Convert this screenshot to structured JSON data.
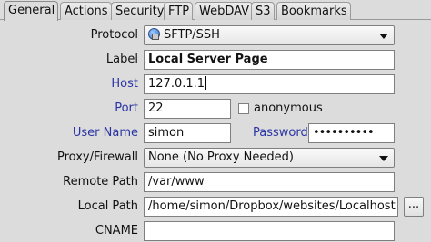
{
  "tabs": [
    {
      "label": "General",
      "active": true
    },
    {
      "label": "Actions"
    },
    {
      "label": "Security"
    },
    {
      "label": "FTP"
    },
    {
      "label": "WebDAV"
    },
    {
      "label": "S3"
    },
    {
      "label": "Bookmarks"
    }
  ],
  "form": {
    "protocol": {
      "label": "Protocol",
      "value": "SFTP/SSH",
      "icon": "sftp-icon"
    },
    "label": {
      "label": "Label",
      "value": "Local Server Page"
    },
    "host": {
      "label": "Host",
      "value": "127.0.1.1"
    },
    "port": {
      "label": "Port",
      "value": "22"
    },
    "anonymous": {
      "label": "anonymous",
      "checked": false
    },
    "username": {
      "label": "User Name",
      "value": "simon"
    },
    "password": {
      "label": "Password",
      "value": "••••••••••"
    },
    "proxy": {
      "label": "Proxy/Firewall",
      "value": "None (No Proxy Needed)"
    },
    "remote_path": {
      "label": "Remote Path",
      "value": "/var/www"
    },
    "local_path": {
      "label": "Local Path",
      "value": "/home/simon/Dropbox/websites/Localhost"
    },
    "browse": {
      "label": "..."
    },
    "cname": {
      "label": "CNAME",
      "value": ""
    }
  },
  "colors": {
    "link_label": "#2a34a3",
    "background": "#dcdcdc"
  }
}
